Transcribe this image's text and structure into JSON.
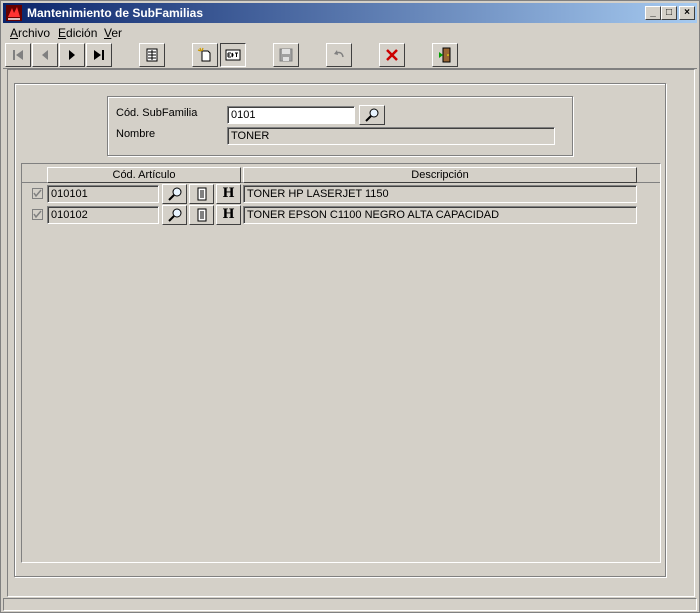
{
  "window": {
    "title": "Mantenimiento de SubFamilias"
  },
  "titlebar_buttons": {
    "minimize": "_",
    "maximize": "□",
    "close": "×"
  },
  "menu": [
    {
      "label_first": "A",
      "label_rest": "rchivo"
    },
    {
      "label_first": "E",
      "label_rest": "dición"
    },
    {
      "label_first": "V",
      "label_rest": "er"
    }
  ],
  "toolbar": {
    "icons": [
      "first-record-icon",
      "previous-record-icon",
      "next-record-icon",
      "last-record-icon",
      "table-view-icon",
      "new-record-icon",
      "edit-record-icon",
      "save-icon",
      "undo-icon",
      "delete-icon",
      "exit-icon"
    ]
  },
  "form": {
    "codigo_label": "Cód. SubFamilia",
    "codigo_value": "0101",
    "nombre_label": "Nombre",
    "nombre_value": "TONER"
  },
  "grid": {
    "columns": [
      "Cód. Artículo",
      "Descripción"
    ],
    "h_button_label": "H",
    "rows": [
      {
        "checked": true,
        "codigo": "010101",
        "descripcion": "TONER HP LASERJET 1150"
      },
      {
        "checked": true,
        "codigo": "010102",
        "descripcion": "TONER EPSON C1100 NEGRO ALTA CAPACIDAD"
      }
    ]
  },
  "colors": {
    "titlebar_start": "#0a246a",
    "titlebar_end": "#a6caf0",
    "face": "#d4d0c8",
    "delete_red": "#cc0000"
  }
}
